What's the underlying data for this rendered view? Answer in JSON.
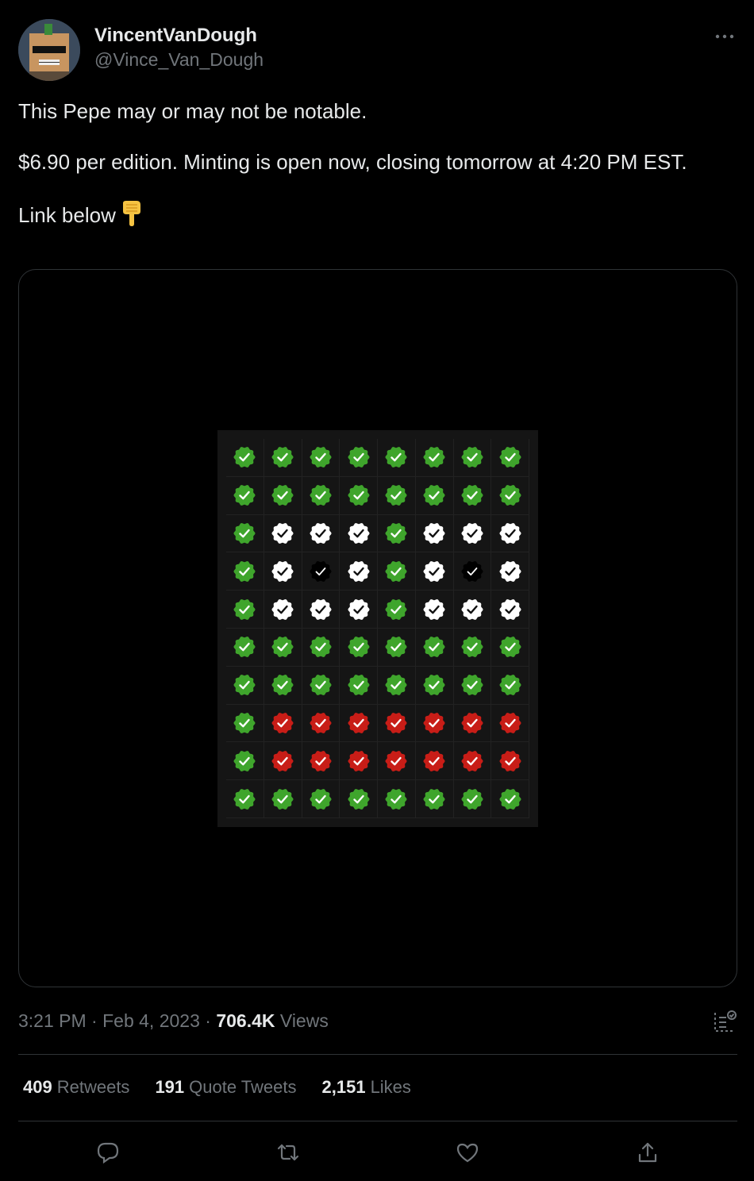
{
  "tweet": {
    "display_name": "VincentVanDough",
    "handle": "@Vince_Van_Dough",
    "text_line1": "This Pepe may or may not be notable.",
    "text_line2": "$6.90 per edition. Minting is open now, closing tomorrow at 4:20 PM EST.",
    "text_line3": "Link below",
    "emoji": "backhand-index-pointing-down",
    "time": "3:21 PM",
    "date": "Feb 4, 2023",
    "views_count": "706.4K",
    "views_label": "Views"
  },
  "stats": {
    "retweets_count": "409",
    "retweets_label": "Retweets",
    "quotes_count": "191",
    "quotes_label": "Quote Tweets",
    "likes_count": "2,151",
    "likes_label": "Likes"
  },
  "icons": {
    "more": "more-icon",
    "analytics": "analytics-icon",
    "reply": "reply-icon",
    "retweet": "retweet-icon",
    "like": "like-icon",
    "share": "share-icon"
  },
  "colors": {
    "green": "#3fa52c",
    "white": "#ffffff",
    "black": "#000000",
    "red": "#c81d17"
  },
  "badge_grid": [
    [
      "green",
      "green",
      "green",
      "green",
      "green",
      "green",
      "green",
      "green"
    ],
    [
      "green",
      "green",
      "green",
      "green",
      "green",
      "green",
      "green",
      "green"
    ],
    [
      "green",
      "white",
      "white",
      "white",
      "green",
      "white",
      "white",
      "white"
    ],
    [
      "green",
      "white",
      "black",
      "white",
      "green",
      "white",
      "black",
      "white"
    ],
    [
      "green",
      "white",
      "white",
      "white",
      "green",
      "white",
      "white",
      "white"
    ],
    [
      "green",
      "green",
      "green",
      "green",
      "green",
      "green",
      "green",
      "green"
    ],
    [
      "green",
      "green",
      "green",
      "green",
      "green",
      "green",
      "green",
      "green"
    ],
    [
      "green",
      "red",
      "red",
      "red",
      "red",
      "red",
      "red",
      "red"
    ],
    [
      "green",
      "red",
      "red",
      "red",
      "red",
      "red",
      "red",
      "red"
    ],
    [
      "green",
      "green",
      "green",
      "green",
      "green",
      "green",
      "green",
      "green"
    ]
  ]
}
